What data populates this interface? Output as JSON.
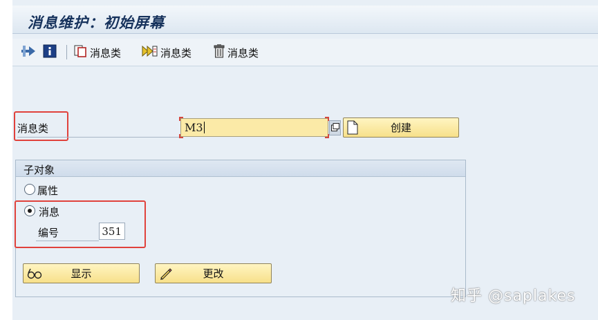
{
  "title": "消息维护：初始屏幕",
  "toolbar": {
    "items": [
      {
        "icon": "variant-arrow-icon",
        "label": ""
      },
      {
        "icon": "info-icon",
        "label": ""
      },
      {
        "icon": "copy-icon",
        "label": "消息类"
      },
      {
        "icon": "rename-icon",
        "label": "消息类"
      },
      {
        "icon": "delete-icon",
        "label": "消息类"
      }
    ]
  },
  "form": {
    "message_class_label": "消息类",
    "message_class_value": "M3",
    "create_button": "创建"
  },
  "subobject": {
    "title": "子对象",
    "options": [
      {
        "label": "属性",
        "selected": false
      },
      {
        "label": "消息",
        "selected": true
      }
    ],
    "number_label": "编号",
    "number_value": "351"
  },
  "actions": {
    "display_button": "显示",
    "change_button": "更改"
  },
  "watermark": "知乎 @saplakes",
  "colors": {
    "highlight_box": "#e0413b",
    "required_field_bg": "#fbeaa7",
    "button_bg": "#f7e08a"
  }
}
